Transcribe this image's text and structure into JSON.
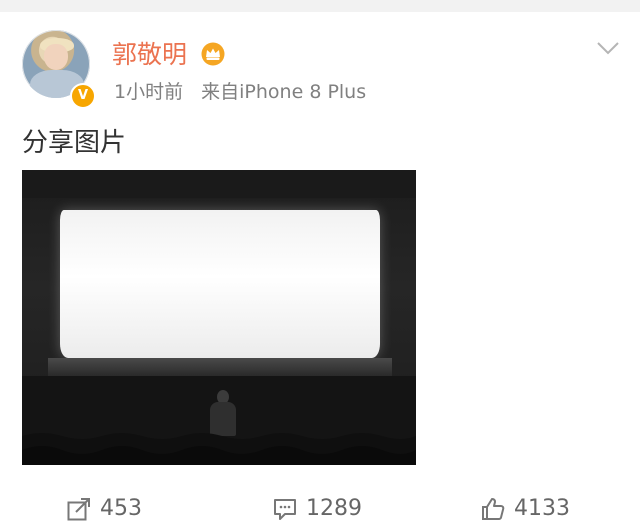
{
  "post": {
    "user": {
      "name": "郭敬明",
      "verified_badge": "V",
      "crown_icon": "crown-icon"
    },
    "meta": {
      "time": "1小时前",
      "source": "来自iPhone 8 Plus"
    },
    "text": "分享图片",
    "image_icon": "cinema-photo"
  },
  "actions": {
    "share_count": "453",
    "comment_count": "1289",
    "like_count": "4133"
  },
  "colors": {
    "username": "#eb7350",
    "meta": "#808080",
    "badge": "#f7a600"
  }
}
